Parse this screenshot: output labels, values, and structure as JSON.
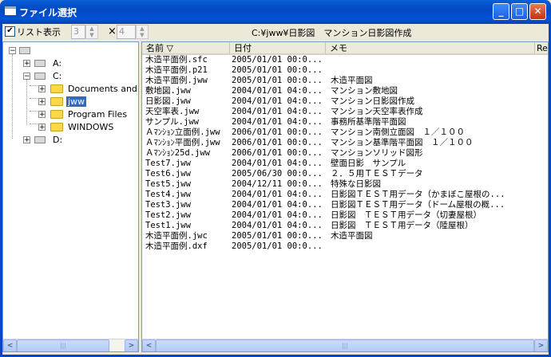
{
  "window": {
    "title": "ファイル選択",
    "min_label": "_",
    "max_label": "□",
    "close_label": "✕"
  },
  "toolbar": {
    "list_checkbox_label": "リスト表示",
    "list_checked": "✔",
    "cols_value": "3",
    "rows_value": "4",
    "times_label": "×",
    "current_path": "C:¥jww¥日影図　マンション日影図作成"
  },
  "tree": {
    "nodes": [
      {
        "label": "",
        "expander": "−"
      },
      {
        "label": "A:",
        "expander": "+"
      },
      {
        "label": "C:",
        "expander": "−"
      },
      {
        "label": "Documents and S",
        "expander": "+"
      },
      {
        "label": "jww",
        "expander": "+"
      },
      {
        "label": "Program Files",
        "expander": "+"
      },
      {
        "label": "WINDOWS",
        "expander": "+"
      },
      {
        "label": "D:",
        "expander": "+"
      }
    ]
  },
  "list": {
    "columns": [
      "名前 ▽",
      "日付",
      "メモ",
      "Rea"
    ],
    "rows": [
      {
        "name": "木造平面例.sfc",
        "date": "2005/01/01 00:0...",
        "memo": ""
      },
      {
        "name": "木造平面例.p21",
        "date": "2005/01/01 00:0...",
        "memo": ""
      },
      {
        "name": "木造平面例.jww",
        "date": "2005/01/01 00:0...",
        "memo": "木造平面図"
      },
      {
        "name": "敷地図.jww",
        "date": "2004/01/01 04:0...",
        "memo": "マンション敷地図"
      },
      {
        "name": "日影図.jww",
        "date": "2004/01/01 04:0...",
        "memo": "マンション日影図作成"
      },
      {
        "name": "天空率表.jww",
        "date": "2004/01/01 04:0...",
        "memo": "マンション天空率表作成"
      },
      {
        "name": "サンプル.jww",
        "date": "2004/01/01 04:0...",
        "memo": "事務所基準階平面図"
      },
      {
        "name": "Ａﾏﾝｼｮﾝ立面例.jww",
        "date": "2006/01/01 00:0...",
        "memo": "マンション南側立面図　１／１００"
      },
      {
        "name": "Ａﾏﾝｼｮﾝ平面例.jww",
        "date": "2006/01/01 00:0...",
        "memo": "マンション基準階平面図　１／１００"
      },
      {
        "name": "Ａﾏﾝｼｮﾝ25d.jww",
        "date": "2006/01/01 00:0...",
        "memo": "マンションソリッド図形"
      },
      {
        "name": "Test7.jww",
        "date": "2004/01/01 04:0...",
        "memo": "壁面日影　サンプル"
      },
      {
        "name": "Test6.jww",
        "date": "2005/06/30 00:0...",
        "memo": "２．５用ＴＥＳＴデータ"
      },
      {
        "name": "Test5.jww",
        "date": "2004/12/11 00:0...",
        "memo": "特殊な日影図"
      },
      {
        "name": "Test4.jww",
        "date": "2004/01/01 04:0...",
        "memo": "日影図ＴＥＳＴ用データ（かまぼこ屋根の..."
      },
      {
        "name": "Test3.jww",
        "date": "2004/01/01 04:0...",
        "memo": "日影図ＴＥＳＴ用データ（ドーム屋根の概..."
      },
      {
        "name": "Test2.jww",
        "date": "2004/01/01 04:0...",
        "memo": "日影図　ＴＥＳＴ用データ（切妻屋根）"
      },
      {
        "name": "Test1.jww",
        "date": "2004/01/01 04:0...",
        "memo": "日影図　ＴＥＳＴ用データ（陸屋根）"
      },
      {
        "name": "木造平面例.jwc",
        "date": "2005/01/01 00:0...",
        "memo": "木造平面図"
      },
      {
        "name": "木造平面例.dxf",
        "date": "2005/01/01 00:0...",
        "memo": ""
      }
    ]
  },
  "scrollbars": {
    "left_arrow": "<",
    "right_arrow": ">",
    "grip": "|||"
  },
  "colors": {
    "title_blue": "#0348c2",
    "selection": "#316ac5",
    "folder": "#ffd84a"
  }
}
